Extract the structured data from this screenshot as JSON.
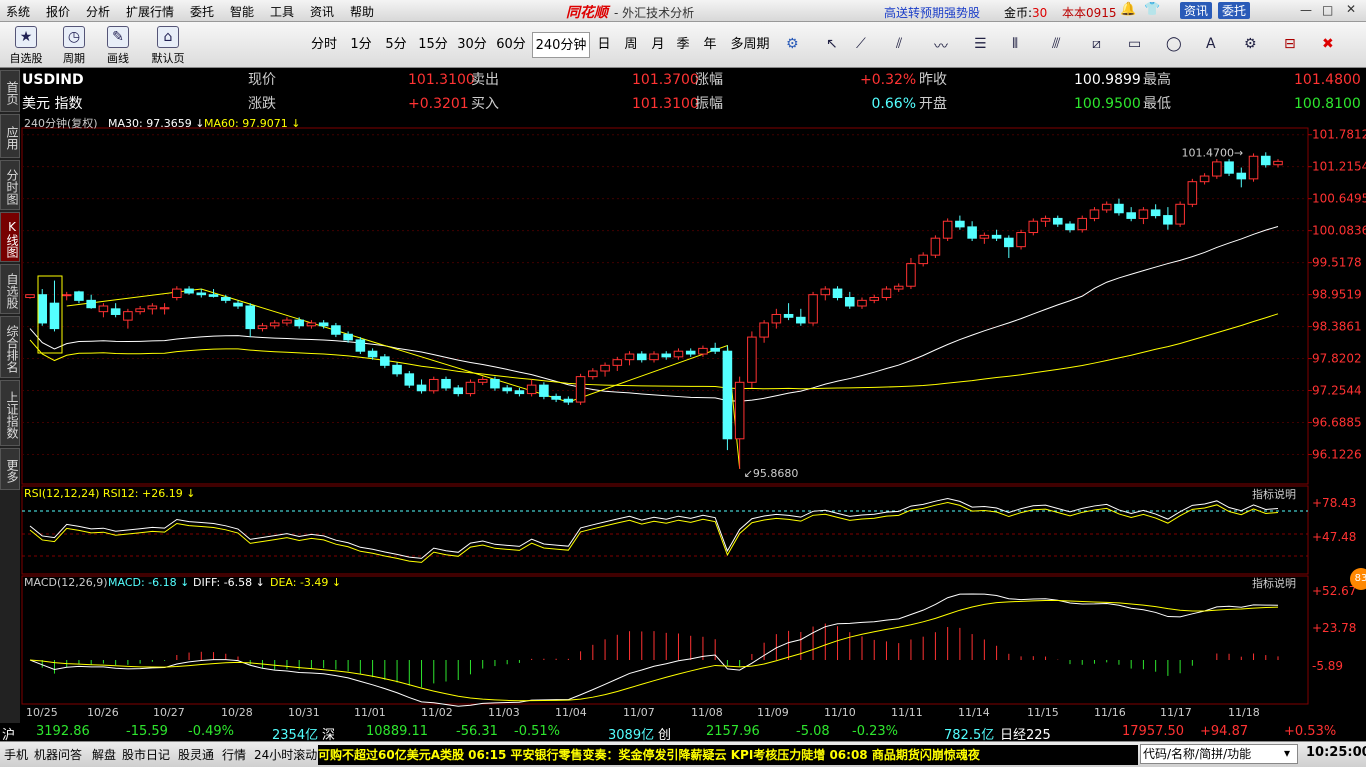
{
  "menu": [
    "系统",
    "报价",
    "分析",
    "扩展行情",
    "委托",
    "智能",
    "工具",
    "资讯",
    "帮助"
  ],
  "brand": "同花顺",
  "window_title": "- 外汇技术分析",
  "promo": "高送转预期强势股",
  "coin_label": "金币:",
  "coin_value": "30",
  "user": "本本0915",
  "top_buttons": [
    "资讯",
    "委托"
  ],
  "tools": [
    {
      "label": "自选股",
      "icon": "star-icon",
      "glyph": "★"
    },
    {
      "label": "周期",
      "icon": "clock-icon",
      "glyph": "◷"
    },
    {
      "label": "画线",
      "icon": "pen-icon",
      "glyph": "✎"
    },
    {
      "label": "默认页",
      "icon": "home-icon",
      "glyph": "⌂"
    }
  ],
  "periods": [
    "分时",
    "1分",
    "5分",
    "15分",
    "30分",
    "60分",
    "240分钟",
    "日",
    "周",
    "月",
    "季",
    "年",
    "多周期"
  ],
  "active_period": "240分钟",
  "sidebar_tabs": [
    "首页",
    "应用",
    "分时图",
    "K线图",
    "自选股",
    "综合排名",
    "上证指数",
    "更多"
  ],
  "active_tab": "K线图",
  "quote": {
    "code": "USDIND",
    "name": "美元 指数",
    "labels": [
      "现价",
      "涨跌",
      "卖出",
      "买入",
      "涨幅",
      "振幅",
      "昨收",
      "开盘",
      "最高",
      "最低"
    ],
    "values": {
      "现价": "101.3100",
      "涨跌": "+0.3201",
      "卖出": "101.3700",
      "买入": "101.3100",
      "涨幅": "+0.32%",
      "振幅": "0.66%",
      "昨收": "100.9899",
      "开盘": "100.9500",
      "最高": "101.4800",
      "最低": "100.8100"
    }
  },
  "ma_legend": {
    "period": "240分钟(复权)",
    "ma30": "MA30: 97.3659",
    "ma60": "MA60: 97.9071"
  },
  "price_axis": [
    "101.7812",
    "101.2154",
    "100.6495",
    "100.0836",
    "99.5178",
    "98.9519",
    "98.3861",
    "97.8202",
    "97.2544",
    "96.6885",
    "96.1226"
  ],
  "high_label": "101.4700",
  "low_label": "95.8680",
  "rsi": {
    "legend": "RSI(12,12,24) RSI12: +26.19",
    "axis": [
      "+78.43",
      "+47.48"
    ],
    "explain": "指标说明"
  },
  "macd": {
    "legend_prefix": "MACD(12,26,9)",
    "macd": "MACD: -6.18",
    "diff": "DIFF: -6.58",
    "dea": "DEA: -3.49",
    "axis": [
      "+52.67",
      "+23.78",
      "-5.89"
    ],
    "explain": "指标说明"
  },
  "dates": [
    "10/25",
    "10/26",
    "10/27",
    "10/28",
    "10/31",
    "11/01",
    "11/02",
    "11/03",
    "11/04",
    "11/07",
    "11/08",
    "11/09",
    "11/10",
    "11/11",
    "11/14",
    "11/15",
    "11/16",
    "11/17",
    "11/18"
  ],
  "badge": "83",
  "status": {
    "sh_label": "沪",
    "sh_val": "3192.86",
    "sh_chg": "-15.59",
    "sh_pct": "-0.49%",
    "sh_amt": "2354亿",
    "sz_label": "深",
    "sz_val": "10889.11",
    "sz_chg": "-56.31",
    "sz_pct": "-0.51%",
    "sz_amt": "3089亿",
    "cy_label": "创",
    "cy_val": "2157.96",
    "cy_chg": "-5.08",
    "cy_pct": "-0.23%",
    "cy_amt": "782.5亿",
    "nk_label": "日经225",
    "nk_val": "17957.50",
    "nk_chg": "+94.87",
    "nk_pct": "+0.53%"
  },
  "taskbar": [
    "手机",
    "机器问答",
    "解盘",
    "股市日记",
    "股灵通",
    "行情",
    "24小时滚动"
  ],
  "ticker": "可购不超过60亿美元A类股    06:15 平安银行零售变奏：奖金停发引降薪疑云 KPI考核压力陡增    06:08 商品期货闪崩惊魂夜",
  "search_placeholder": "代码/名称/简拼/功能",
  "clock": "10:25:00",
  "colors": {
    "up": "#ff3232",
    "down": "#54ffff",
    "ma30": "#ffffff",
    "ma60": "#ffff00"
  },
  "chart_data": {
    "type": "candlestick",
    "ylim": [
      95.6,
      101.9
    ],
    "candles": [
      [
        98.9,
        98.95,
        98.88,
        98.95
      ],
      [
        98.95,
        99.05,
        98.4,
        98.45
      ],
      [
        98.8,
        99.2,
        98.3,
        98.35
      ],
      [
        98.95,
        99.0,
        98.85,
        98.95
      ],
      [
        99.0,
        99.02,
        98.8,
        98.85
      ],
      [
        98.85,
        98.95,
        98.7,
        98.72
      ],
      [
        98.65,
        98.8,
        98.55,
        98.75
      ],
      [
        98.7,
        98.8,
        98.55,
        98.6
      ],
      [
        98.5,
        98.7,
        98.35,
        98.65
      ],
      [
        98.65,
        98.75,
        98.6,
        98.7
      ],
      [
        98.7,
        98.8,
        98.6,
        98.75
      ],
      [
        98.7,
        98.8,
        98.6,
        98.72
      ],
      [
        98.9,
        99.1,
        98.85,
        99.05
      ],
      [
        99.05,
        99.1,
        98.95,
        98.98
      ],
      [
        98.98,
        99.05,
        98.9,
        98.95
      ],
      [
        98.95,
        99.05,
        98.9,
        98.92
      ],
      [
        98.9,
        98.95,
        98.8,
        98.85
      ],
      [
        98.8,
        98.85,
        98.7,
        98.75
      ],
      [
        98.75,
        98.8,
        98.2,
        98.35
      ],
      [
        98.35,
        98.45,
        98.3,
        98.4
      ],
      [
        98.4,
        98.5,
        98.35,
        98.45
      ],
      [
        98.45,
        98.55,
        98.4,
        98.5
      ],
      [
        98.5,
        98.55,
        98.35,
        98.4
      ],
      [
        98.4,
        98.5,
        98.35,
        98.45
      ],
      [
        98.45,
        98.5,
        98.35,
        98.4
      ],
      [
        98.4,
        98.45,
        98.2,
        98.25
      ],
      [
        98.25,
        98.3,
        98.1,
        98.15
      ],
      [
        98.15,
        98.2,
        97.9,
        97.95
      ],
      [
        97.95,
        98.0,
        97.8,
        97.85
      ],
      [
        97.85,
        97.9,
        97.65,
        97.7
      ],
      [
        97.7,
        97.75,
        97.5,
        97.55
      ],
      [
        97.55,
        97.6,
        97.3,
        97.35
      ],
      [
        97.35,
        97.45,
        97.2,
        97.25
      ],
      [
        97.25,
        97.5,
        97.2,
        97.45
      ],
      [
        97.45,
        97.5,
        97.25,
        97.3
      ],
      [
        97.3,
        97.35,
        97.15,
        97.2
      ],
      [
        97.2,
        97.45,
        97.15,
        97.4
      ],
      [
        97.4,
        97.5,
        97.35,
        97.45
      ],
      [
        97.45,
        97.5,
        97.25,
        97.3
      ],
      [
        97.3,
        97.35,
        97.2,
        97.25
      ],
      [
        97.25,
        97.3,
        97.15,
        97.2
      ],
      [
        97.2,
        97.45,
        97.15,
        97.35
      ],
      [
        97.35,
        97.4,
        97.1,
        97.15
      ],
      [
        97.15,
        97.2,
        97.05,
        97.1
      ],
      [
        97.1,
        97.15,
        97.0,
        97.05
      ],
      [
        97.05,
        97.55,
        97.0,
        97.5
      ],
      [
        97.5,
        97.65,
        97.45,
        97.6
      ],
      [
        97.6,
        97.75,
        97.5,
        97.7
      ],
      [
        97.7,
        97.85,
        97.6,
        97.8
      ],
      [
        97.8,
        97.95,
        97.7,
        97.9
      ],
      [
        97.9,
        97.95,
        97.75,
        97.8
      ],
      [
        97.8,
        97.95,
        97.75,
        97.9
      ],
      [
        97.9,
        97.95,
        97.8,
        97.85
      ],
      [
        97.85,
        98.0,
        97.8,
        97.95
      ],
      [
        97.95,
        98.0,
        97.85,
        97.9
      ],
      [
        97.9,
        98.05,
        97.85,
        98.0
      ],
      [
        98.0,
        98.1,
        97.9,
        97.95
      ],
      [
        97.95,
        98.05,
        96.2,
        96.4
      ],
      [
        96.4,
        97.5,
        95.87,
        97.4
      ],
      [
        97.4,
        98.3,
        97.3,
        98.2
      ],
      [
        98.2,
        98.5,
        98.1,
        98.45
      ],
      [
        98.45,
        98.7,
        98.35,
        98.6
      ],
      [
        98.6,
        98.8,
        98.5,
        98.55
      ],
      [
        98.55,
        98.7,
        98.4,
        98.45
      ],
      [
        98.45,
        99.0,
        98.4,
        98.95
      ],
      [
        98.95,
        99.1,
        98.85,
        99.05
      ],
      [
        99.05,
        99.1,
        98.85,
        98.9
      ],
      [
        98.9,
        99.0,
        98.7,
        98.75
      ],
      [
        98.75,
        98.9,
        98.7,
        98.85
      ],
      [
        98.85,
        98.95,
        98.8,
        98.9
      ],
      [
        98.9,
        99.1,
        98.85,
        99.05
      ],
      [
        99.05,
        99.15,
        99.0,
        99.1
      ],
      [
        99.1,
        99.6,
        99.05,
        99.5
      ],
      [
        99.5,
        99.7,
        99.45,
        99.65
      ],
      [
        99.65,
        100.0,
        99.6,
        99.95
      ],
      [
        99.95,
        100.3,
        99.9,
        100.25
      ],
      [
        100.25,
        100.35,
        100.1,
        100.15
      ],
      [
        100.15,
        100.25,
        99.9,
        99.95
      ],
      [
        99.95,
        100.05,
        99.85,
        100.0
      ],
      [
        100.0,
        100.1,
        99.9,
        99.95
      ],
      [
        99.95,
        100.0,
        99.6,
        99.8
      ],
      [
        99.8,
        100.1,
        99.75,
        100.05
      ],
      [
        100.05,
        100.3,
        100.0,
        100.25
      ],
      [
        100.25,
        100.35,
        100.15,
        100.3
      ],
      [
        100.3,
        100.35,
        100.15,
        100.2
      ],
      [
        100.2,
        100.25,
        100.05,
        100.1
      ],
      [
        100.1,
        100.35,
        100.05,
        100.3
      ],
      [
        100.3,
        100.5,
        100.25,
        100.45
      ],
      [
        100.45,
        100.6,
        100.4,
        100.55
      ],
      [
        100.55,
        100.65,
        100.35,
        100.4
      ],
      [
        100.4,
        100.5,
        100.25,
        100.3
      ],
      [
        100.3,
        100.5,
        100.2,
        100.45
      ],
      [
        100.45,
        100.55,
        100.3,
        100.35
      ],
      [
        100.35,
        100.5,
        100.1,
        100.2
      ],
      [
        100.2,
        100.6,
        100.15,
        100.55
      ],
      [
        100.55,
        101.0,
        100.5,
        100.95
      ],
      [
        100.95,
        101.1,
        100.9,
        101.05
      ],
      [
        101.05,
        101.35,
        101.0,
        101.3
      ],
      [
        101.3,
        101.35,
        101.05,
        101.1
      ],
      [
        101.1,
        101.2,
        100.85,
        101.0
      ],
      [
        101.0,
        101.45,
        100.95,
        101.4
      ],
      [
        101.4,
        101.47,
        101.2,
        101.25
      ],
      [
        101.25,
        101.35,
        101.2,
        101.31
      ]
    ]
  }
}
